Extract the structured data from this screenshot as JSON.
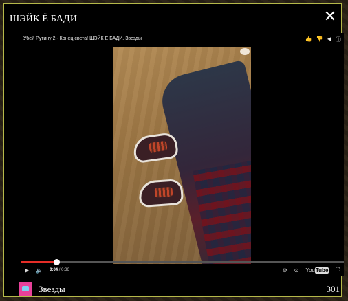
{
  "modal": {
    "title": "ШЭЙК Ё БАДИ",
    "close_icon": "close-icon",
    "border_color": "#b5b84a"
  },
  "video": {
    "title": "Убей Рутину 2 - Конец света! ШЭЙК Ё БАДИ. Звезды",
    "actions": [
      "like-icon",
      "dislike-icon",
      "share-icon",
      "info-icon"
    ],
    "progress": 0.11,
    "time_current": "0:04",
    "time_separator": " / ",
    "time_total": "0:36",
    "progress_color": "#e52d27",
    "youtube_label": "You",
    "youtube_box": "Tube"
  },
  "footer": {
    "channel_name": "Звезды",
    "count": "301",
    "channel_icon": "cup-icon"
  }
}
